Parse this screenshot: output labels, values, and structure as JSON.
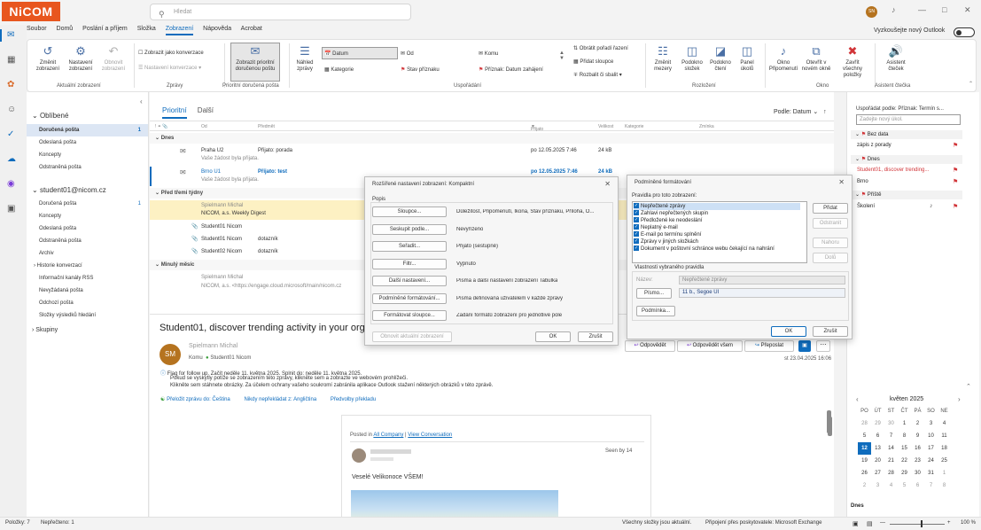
{
  "titlebar": {
    "logo": "NiCOM",
    "search_placeholder": "Hledat",
    "avatar": "SN"
  },
  "menu": {
    "tabs": [
      "Soubor",
      "Domů",
      "Poslání a příjem",
      "Složka",
      "Zobrazení",
      "Nápověda",
      "Acrobat"
    ],
    "active": "Zobrazení",
    "try_new": "Vyzkoušejte nový Outlook"
  },
  "ribbon": {
    "change_view": "Změnit zobrazení",
    "view_settings": "Nastavení zobrazení",
    "reset_view": "Obnovit zobrazení",
    "show_as_conv": "Zobrazit jako konverzace",
    "conv_settings": "Nastavení konverzace",
    "focused_inbox": "Zobrazit prioritní doručenou poštu",
    "preview": "Náhled zprávy",
    "arr_date": "Datum",
    "arr_from": "Od",
    "arr_to": "Komu",
    "arr_category": "Kategorie",
    "arr_flag": "Stav příznaku",
    "arr_flag_start": "Příznak: Datum zahájení",
    "reverse_sort": "Obrátit pořadí řazení",
    "add_columns": "Přidat sloupce",
    "expand": "Rozbalit či sbalit",
    "col_spacing": "Změnit mezery",
    "folder_pane": "Podokno složek",
    "reading_pane": "Podokno čtení",
    "todo_bar": "Panel úkolů",
    "reminders": "Okno Připomenutí",
    "new_window": "Otevřít v novém okně",
    "close_all": "Zavřít všechny položky",
    "assistant": "Asistent čteček",
    "groups": [
      "Aktuální zobrazení",
      "Zprávy",
      "Prioritní doručená pošta",
      "Uspořádání",
      "Rozložení",
      "Okno",
      "Asistent čtečka"
    ]
  },
  "folders": {
    "fav_header": "Oblíbené",
    "favorites": [
      {
        "name": "Doručená pošta",
        "count": "1"
      },
      {
        "name": "Odeslaná pošta",
        "count": ""
      },
      {
        "name": "Koncepty",
        "count": ""
      },
      {
        "name": "Odstraněná pošta",
        "count": ""
      }
    ],
    "account": "student01@nicom.cz",
    "items": [
      {
        "name": "Doručená pošta",
        "count": "1"
      },
      {
        "name": "Koncepty",
        "count": ""
      },
      {
        "name": "Odeslaná pošta",
        "count": ""
      },
      {
        "name": "Odstraněná pošta",
        "count": ""
      },
      {
        "name": "Archiv",
        "count": ""
      },
      {
        "name": "Historie konverzací",
        "count": ""
      },
      {
        "name": "Informační kanály RSS",
        "count": ""
      },
      {
        "name": "Nevyžádaná pošta",
        "count": ""
      },
      {
        "name": "Odchozí pošta",
        "count": ""
      },
      {
        "name": "Složky výsledků hledání",
        "count": ""
      }
    ],
    "groups": "Skupiny"
  },
  "list": {
    "tab_focused": "Prioritní",
    "tab_other": "Další",
    "sort": "Podle: Datum",
    "columns": [
      "Od",
      "Předmět",
      "Přijato",
      "Velikost",
      "Kategorie",
      "Zmínka"
    ],
    "group_today": "Dnes",
    "group_older": "Před třemi týdny",
    "group_month": "Minulý měsíc",
    "rows": [
      {
        "from": "Praha U2",
        "subject": "Přijato: porada",
        "sub": "Vaše žádost byla přijata.",
        "date": "po 12.05.2025 7:46",
        "size": "24 kB"
      },
      {
        "from": "Brno U1",
        "subject": "Přijato: test",
        "sub": "Vaše žádost byla přijata.",
        "date": "po 12.05.2025 7:46",
        "size": "24 kB"
      },
      {
        "from": "Spielmann Michal",
        "subject": "",
        "sub": "NICOM, a.s. Weekly Digest",
        "date": "",
        "size": ""
      },
      {
        "from": "Student01 Nicom",
        "subject": "",
        "sub": "",
        "date": "",
        "size": ""
      },
      {
        "from": "Student01 Nicom",
        "subject": "dotazník",
        "sub": "",
        "date": "",
        "size": ""
      },
      {
        "from": "Student02 Nicom",
        "subject": "dotazník",
        "sub": "",
        "date": "",
        "size": ""
      },
      {
        "from": "Spielmann Michal",
        "subject": "",
        "sub": "NICOM, a.s. <https://engage.cloud.microsoft/main/nicom.cz",
        "date": "",
        "size": ""
      }
    ]
  },
  "reading": {
    "subject": "Student01, discover trending activity in your org",
    "avatar": "SM",
    "sender": "Spielmann Michal",
    "to_label": "Komu",
    "to": "Student01 Nicom",
    "date": "st 23.04.2025 16:06",
    "reply": "Odpovědět",
    "reply_all": "Odpovědět všem",
    "forward": "Přeposlat",
    "flag_line": "Flag for follow up. Začít neděle 11. května 2025. Splnit do: neděle 11. května 2025.",
    "web_line": "Pokud se vyskytly potíže se zobrazením této zprávy, klikněte sem a zobrazte ve webovém prohlížeči.",
    "privacy_line": "Klikněte sem stáhnete obrázky. Za účelem ochrany vašeho soukromí zabránila aplikace Outlook stažení některých obrázků v této zprávě.",
    "translate": "Přeložit zprávu do: Čeština",
    "never_translate": "Nikdy nepřekládat z: Angličtina",
    "translate_prefs": "Předvolby překladu",
    "posted_prefix": "Posted in",
    "posted_link1": "All Company",
    "posted_link2": "View Conversation",
    "seen_by": "Seen by 14",
    "greeting": "Veselé Velikonoce VŠEM!"
  },
  "todo": {
    "arrange": "Uspořádat podle: Příznak: Termín s...",
    "new_task": "Zadejte nový úkol.",
    "no_date": "Bez data",
    "task1": "zápis z porady",
    "today": "Dnes",
    "task2": "Student01, discover trending...",
    "task3": "Brno",
    "future": "Příště",
    "task4": "Školení",
    "cal_title": "květen 2025",
    "weekdays": [
      "PO",
      "ÚT",
      "ST",
      "ČT",
      "PÁ",
      "SO",
      "NE"
    ],
    "weeks": [
      [
        "28",
        "29",
        "30",
        "1",
        "2",
        "3",
        "4"
      ],
      [
        "5",
        "6",
        "7",
        "8",
        "9",
        "10",
        "11"
      ],
      [
        "12",
        "13",
        "14",
        "15",
        "16",
        "17",
        "18"
      ],
      [
        "19",
        "20",
        "21",
        "22",
        "23",
        "24",
        "25"
      ],
      [
        "26",
        "27",
        "28",
        "29",
        "30",
        "31",
        "1"
      ],
      [
        "2",
        "3",
        "4",
        "5",
        "6",
        "7",
        "8"
      ]
    ],
    "selected_day": "12",
    "today_footer": "Dnes"
  },
  "dialog1": {
    "title": "Rozšířené nastavení zobrazení: Kompaktní",
    "desc": "Popis",
    "rows": [
      {
        "btn": "Sloupce...",
        "val": "Důležitost, Připomenutí, Ikona, Stav příznaku, Příloha, O..."
      },
      {
        "btn": "Seskupit podle...",
        "val": "Nevyřízeno"
      },
      {
        "btn": "Seřadit...",
        "val": "Přijato (sestupně)"
      },
      {
        "btn": "Filtr...",
        "val": "Vypnuto"
      },
      {
        "btn": "Další nastavení...",
        "val": "Písma a další nastavení zobrazení Tabulka"
      },
      {
        "btn": "Podmíněné formátování...",
        "val": "Písma definovaná uživatelem v každé zprávy"
      },
      {
        "btn": "Formátovat sloupce...",
        "val": "Zadání formátů zobrazení pro jednotlivé pole"
      }
    ],
    "reset": "Obnovit aktuální zobrazení",
    "ok": "OK",
    "cancel": "Zrušit"
  },
  "dialog2": {
    "title": "Podmíněné formátování",
    "rules_label": "Pravidla pro toto zobrazení:",
    "rules": [
      "Nepřečtené zprávy",
      "Zahlavi nepřečtených skupin",
      "Předložené ke neodeslání",
      "Neplatný e-mail",
      "E-mail po termínu splnění",
      "Zprávy v jiných složkách",
      "Dokument v poštovní schránce webu čekající na nahrání"
    ],
    "add": "Přidat",
    "delete": "Odstranit",
    "up": "Nahoru",
    "down": "Dolů",
    "props": "Vlastnosti vybraného pravidla",
    "name_label": "Název:",
    "name_value": "Nepřečtené zprávy",
    "font_btn": "Písmo...",
    "font_value": "11 b., Segoe UI",
    "condition": "Podmínka...",
    "ok": "OK",
    "cancel": "Zrušit"
  },
  "status": {
    "items": "Položky: 7",
    "unread": "Nepřečteno: 1",
    "synced": "Všechny složky jsou aktuální.",
    "connected": "Připojení přes poskytovatele: Microsoft Exchange",
    "zoom": "100 %"
  }
}
